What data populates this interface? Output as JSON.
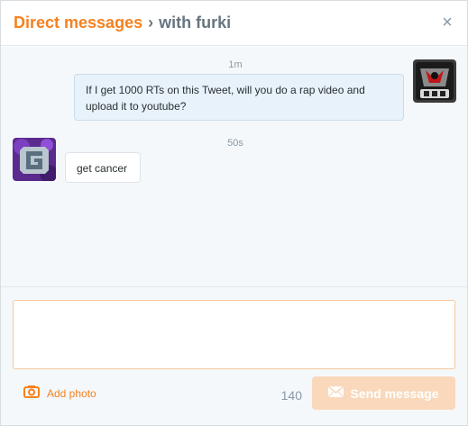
{
  "header": {
    "title": "Direct messages",
    "separator": "›",
    "subtitle": "with furki",
    "close_glyph": "×"
  },
  "messages": [
    {
      "timestamp": "1m",
      "text": "If I get 1000 RTs on this Tweet, will you do a rap video and upload it to youtube?",
      "direction": "sent",
      "avatar_icon": "avatar-red-black-logo"
    },
    {
      "timestamp": "50s",
      "text": "get cancer",
      "direction": "received",
      "avatar_icon": "avatar-purple-g-logo"
    }
  ],
  "composer": {
    "text_value": "",
    "add_photo_label": "Add photo",
    "add_photo_icon": "camera-icon",
    "char_count": "140",
    "send_label": "Send message",
    "send_icon": "envelope-icon"
  },
  "colors": {
    "accent": "#f5811f",
    "send_disabled": "#f9d8bb",
    "sent_bubble": "#e8f2fa",
    "thread_bg": "#f5f8fa"
  }
}
